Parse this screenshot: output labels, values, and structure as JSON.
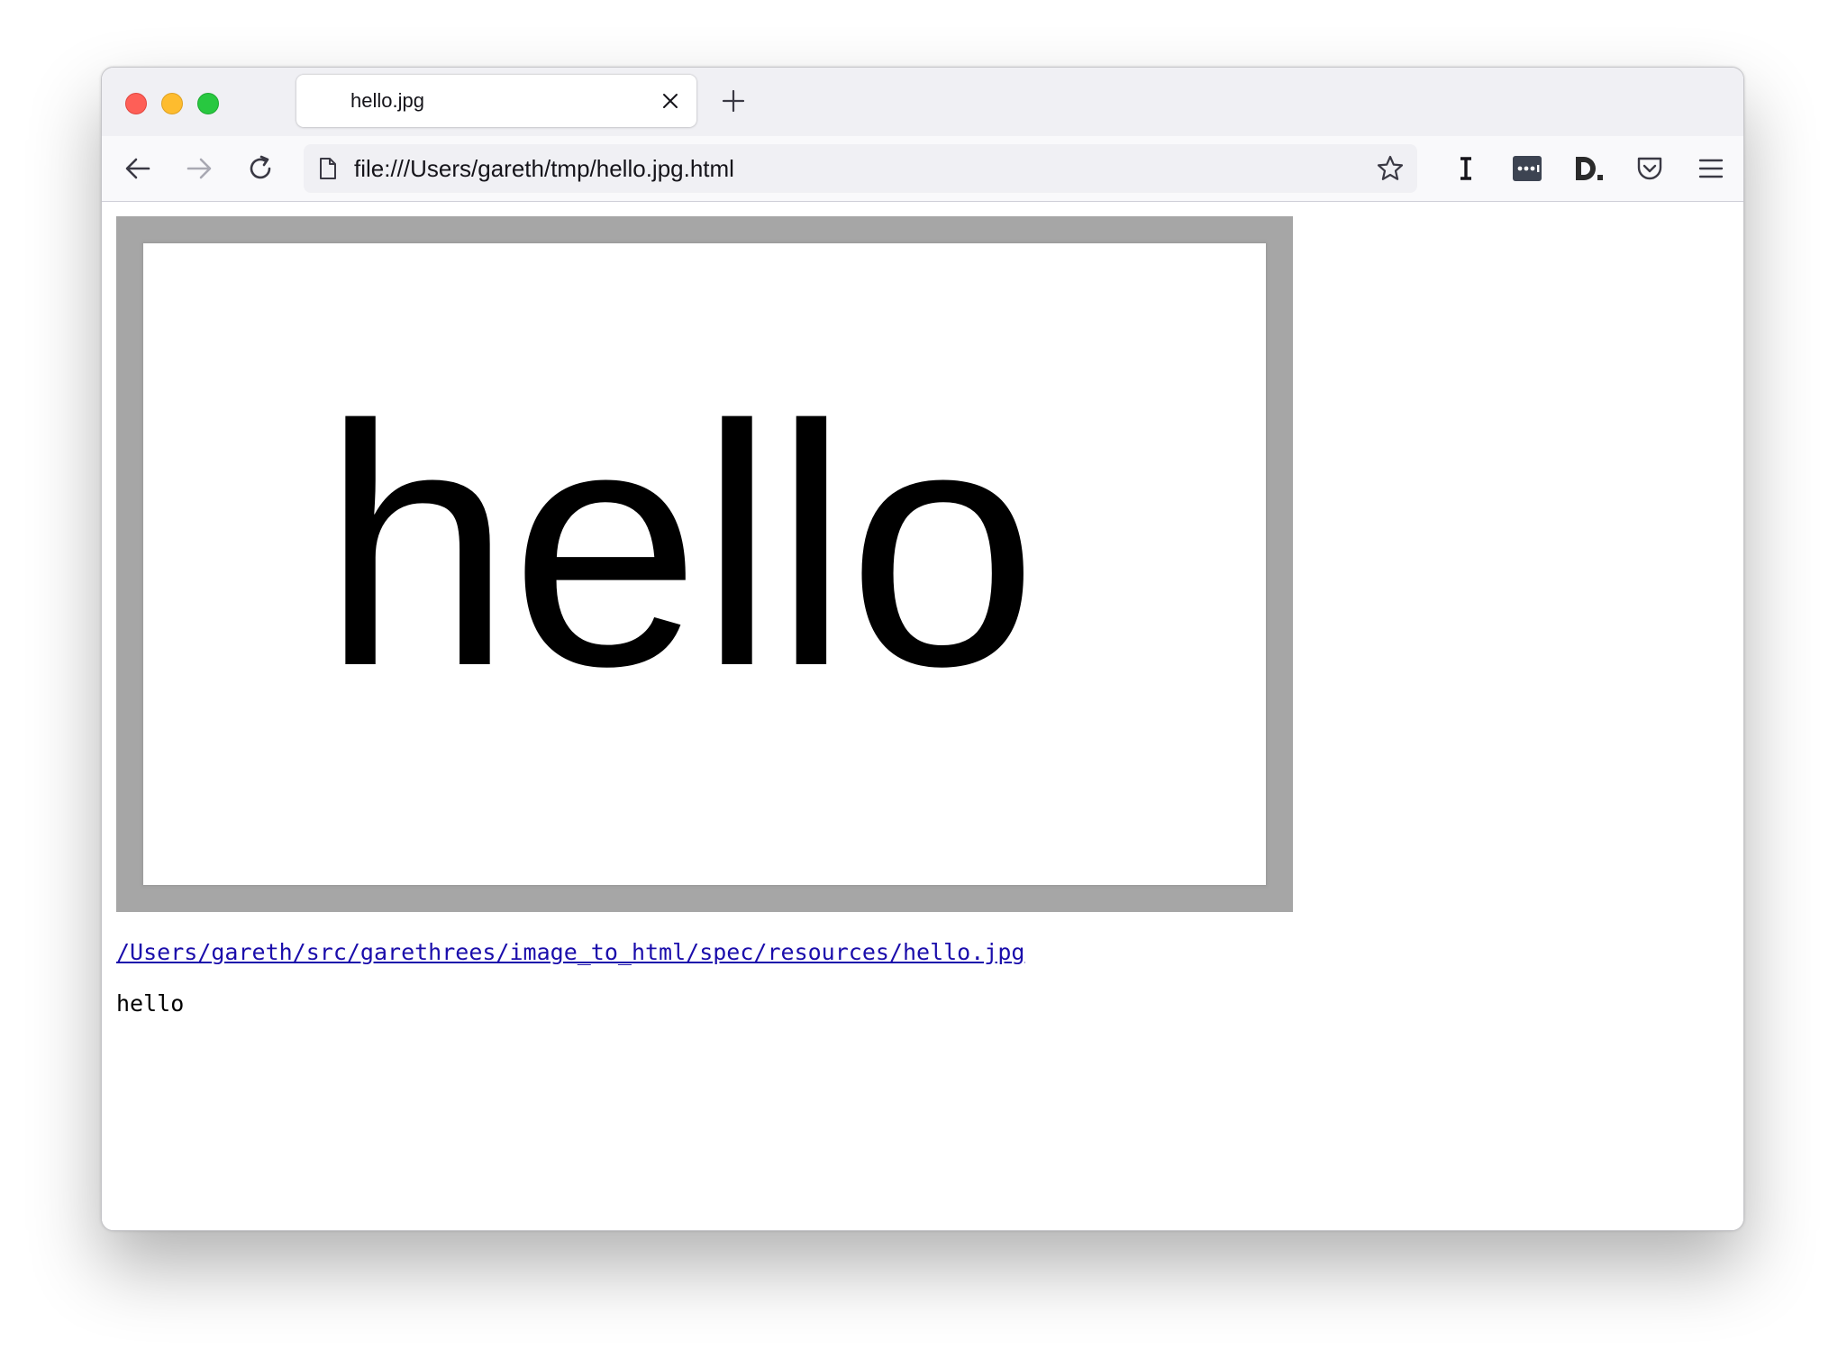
{
  "window": {
    "traffic_lights": [
      "close",
      "minimize",
      "zoom"
    ]
  },
  "tab": {
    "title": "hello.jpg",
    "close_icon": "close-icon"
  },
  "navigation": {
    "back_icon": "arrow-left-icon",
    "forward_icon": "arrow-right-icon",
    "reload_icon": "reload-icon"
  },
  "urlbar": {
    "url": "file:///Users/gareth/tmp/hello.jpg.html",
    "page_icon": "document-icon",
    "bookmark_icon": "star-icon"
  },
  "toolbar": {
    "extensions": [
      "instapaper-icon",
      "ellipsis-box-icon",
      "d-logo-icon",
      "pocket-icon"
    ],
    "menu_icon": "hamburger-menu-icon"
  },
  "page": {
    "image_text": "hello",
    "file_link": "/Users/gareth/src/garethrees/image_to_html/spec/resources/hello.jpg",
    "caption": "hello"
  },
  "colors": {
    "frame_gray": "#a6a6a6",
    "link_blue": "#1a0dab",
    "titlebar": "#f0f0f4",
    "toolbar": "#f9f9fb"
  }
}
